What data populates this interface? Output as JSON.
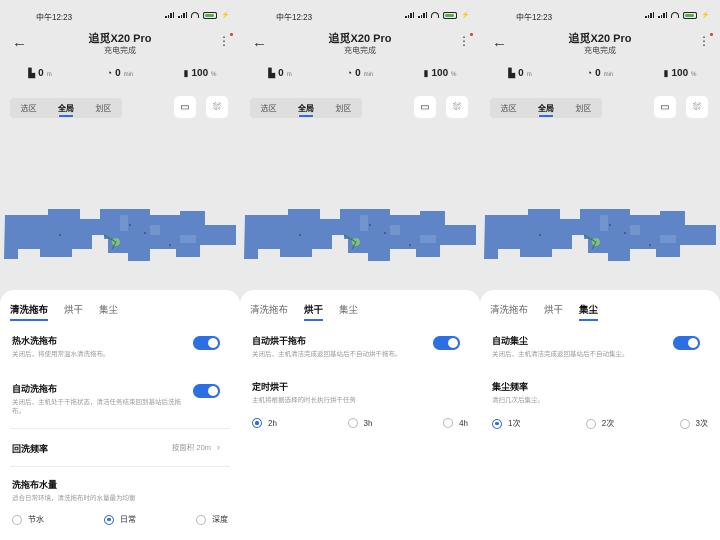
{
  "status": {
    "time": "中午12:23"
  },
  "header": {
    "title": "追觅X20 Pro",
    "subtitle": "充电完成"
  },
  "stats": [
    {
      "icon": "area-icon",
      "value": "0",
      "unit": "m"
    },
    {
      "icon": "clock-icon",
      "value": "0",
      "unit": "min"
    },
    {
      "icon": "battery-icon",
      "value": "100",
      "unit": "%"
    }
  ],
  "map_tabs": [
    "选区",
    "全局",
    "划区"
  ],
  "panel_tabs": [
    "清洗拖布",
    "烘干",
    "集尘"
  ],
  "screen1": {
    "hot_water": {
      "title": "热水洗拖布",
      "desc": "关闭后，将使用常温水清洗拖布。"
    },
    "auto_wash": {
      "title": "自动洗拖布",
      "desc": "关闭后，主机处于干拖状态，清洁任务结束回到基站后洗拖布。"
    },
    "rewash": {
      "title": "回洗频率",
      "value": "按面积 20m"
    },
    "water": {
      "title": "洗拖布水量",
      "desc": "适合日常环境，清洗拖布时的水量最为均衡",
      "options": [
        "节水",
        "日常",
        "深度"
      ],
      "selected": 1
    }
  },
  "screen2": {
    "auto_dry": {
      "title": "自动烘干拖布",
      "desc": "关闭后，主机清洁完成返回基站后不自动烘干拖布。"
    },
    "timed_dry": {
      "title": "定时烘干",
      "desc": "主机将根据选择的时长执行烘干任务",
      "options": [
        "2h",
        "3h",
        "4h"
      ],
      "selected": 0
    }
  },
  "screen3": {
    "auto_dust": {
      "title": "自动集尘",
      "desc": "关闭后，主机清洁完成返回基站后不自动集尘。"
    },
    "dust_freq": {
      "title": "集尘频率",
      "desc": "清扫几次后集尘。",
      "options": [
        "1次",
        "2次",
        "3次"
      ],
      "selected": 0
    }
  },
  "colors": {
    "accent": "#2d6ee0",
    "map_floor": "#5f85c6",
    "map_bg": "#8f8f8f"
  }
}
